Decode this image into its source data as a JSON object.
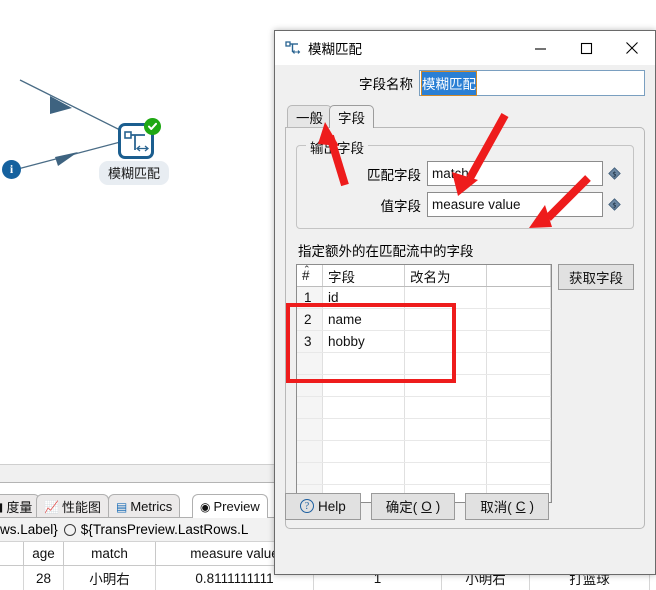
{
  "canvas": {
    "step_label": "模糊匹配",
    "step_status_icon": "check-circle-icon",
    "step_icon": "fuzzy-match-step-icon",
    "info_icon": "info-icon",
    "info_glyph": "i"
  },
  "bottom_panel": {
    "tabs": [
      {
        "label": "度量",
        "icon": "metrics-gauge-icon",
        "glyph": "",
        "active": false
      },
      {
        "label": "性能图",
        "icon": "performance-chart-icon",
        "glyph": "↗",
        "active": false
      },
      {
        "label": "Metrics",
        "icon": "metrics-list-icon",
        "glyph": "☰",
        "active": false
      },
      {
        "label": "Preview",
        "icon": "preview-eye-icon",
        "glyph": "◉",
        "active": true
      }
    ],
    "radio_row": {
      "left_text": "ws.Label}",
      "radio_icon": "radio-button-unchecked",
      "option_text": "${TransPreview.LastRows.L"
    },
    "preview_table": {
      "columns": [
        "",
        "age",
        "match",
        "measure value",
        "",
        "",
        ""
      ],
      "rows": [
        [
          "",
          "28",
          "小明右",
          "0.8111111111",
          "1",
          "小明右",
          "打篮球"
        ]
      ]
    }
  },
  "dialog": {
    "title": "模糊匹配",
    "title_icon": "fuzzy-match-icon",
    "window_buttons": {
      "minimize": "minimize-icon",
      "maximize": "maximize-icon",
      "close": "close-icon"
    },
    "field_name": {
      "label": "字段名称",
      "value": "模糊匹配"
    },
    "tabs": [
      {
        "label": "一般",
        "active": false
      },
      {
        "label": "字段",
        "active": true
      }
    ],
    "output_group": {
      "title": "输出字段",
      "rows": [
        {
          "label": "匹配字段",
          "value": "match",
          "var_icon": "variable-diamond-icon"
        },
        {
          "label": "值字段",
          "value": "measure value",
          "var_icon": "variable-diamond-icon"
        }
      ]
    },
    "extra_fields": {
      "section_label": "指定额外的在匹配流中的字段",
      "columns": [
        "#",
        "字段",
        "改名为",
        ""
      ],
      "sort_icon": "sort-ascending-caret",
      "rows": [
        {
          "n": "1",
          "field": "id",
          "rename": ""
        },
        {
          "n": "2",
          "field": "name",
          "rename": ""
        },
        {
          "n": "3",
          "field": "hobby",
          "rename": ""
        },
        {
          "n": "",
          "field": "",
          "rename": ""
        },
        {
          "n": "",
          "field": "",
          "rename": ""
        },
        {
          "n": "",
          "field": "",
          "rename": ""
        },
        {
          "n": "",
          "field": "",
          "rename": ""
        },
        {
          "n": "",
          "field": "",
          "rename": ""
        },
        {
          "n": "",
          "field": "",
          "rename": ""
        },
        {
          "n": "",
          "field": "",
          "rename": ""
        }
      ],
      "get_fields_button": "获取字段"
    },
    "buttons": {
      "help": "Help",
      "help_icon": "help-question-icon",
      "ok": "确定(O)",
      "ok_text": "确定(",
      "ok_mnemonic": "O",
      "ok_tail": ")",
      "cancel_text": "取消(",
      "cancel_mnemonic": "C",
      "cancel_tail": ")"
    }
  },
  "annotations": {
    "color": "#ee1c1c",
    "arrow_targets": [
      "字段",
      "match",
      "measure value"
    ],
    "highlight_box_target": "extra-fields-rows"
  }
}
